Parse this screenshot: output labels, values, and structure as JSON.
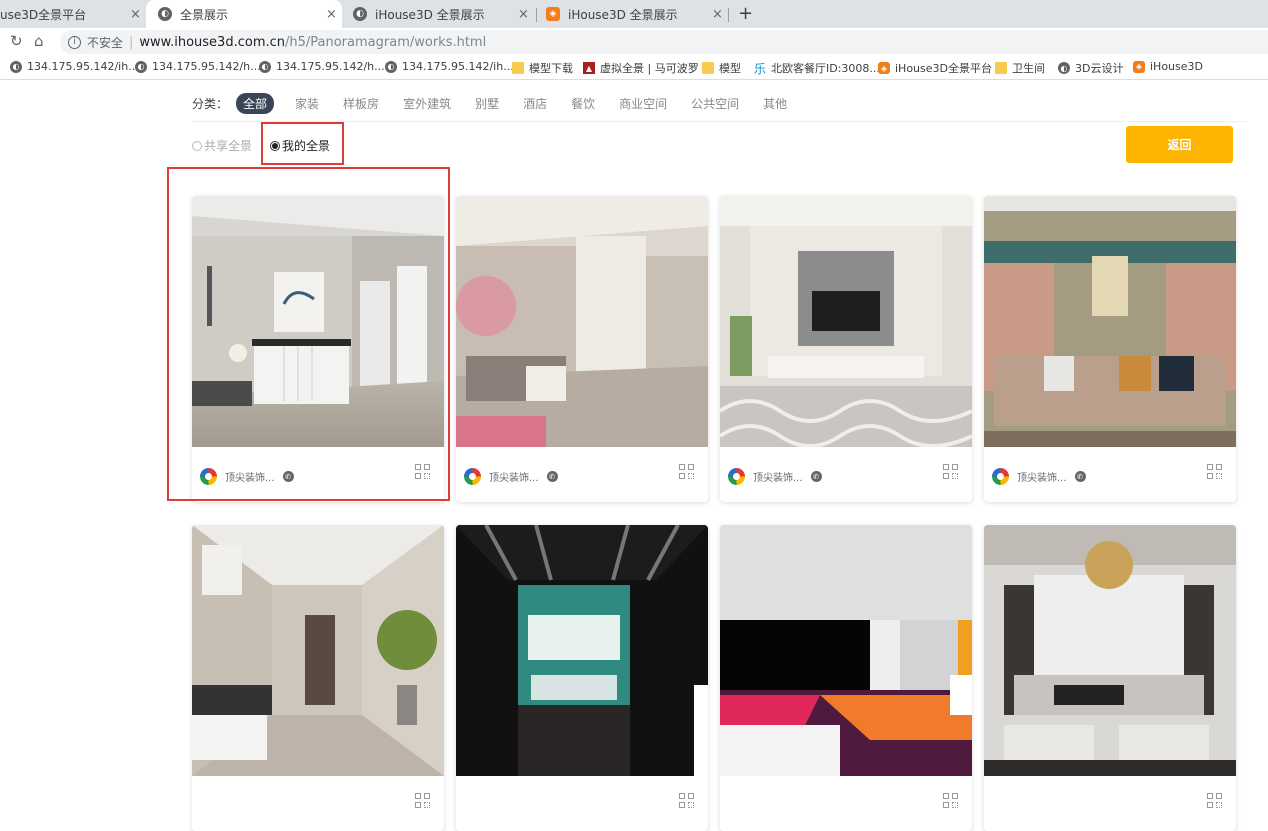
{
  "browser": {
    "tabs": [
      {
        "title": "use3D全景平台",
        "icon": "globe-icon",
        "active": false
      },
      {
        "title": "全景展示",
        "icon": "globe-icon",
        "active": true
      },
      {
        "title": "iHouse3D 全景展示",
        "icon": "globe-icon",
        "active": false
      },
      {
        "title": "iHouse3D 全景展示",
        "icon": "ihouse-logo-icon",
        "active": false
      }
    ],
    "close_glyph": "×",
    "new_tab_glyph": "+",
    "address": {
      "insecure_label": "不安全",
      "host": "www.ihouse3d.com.cn",
      "path": "/h5/Panoramagram/works.html"
    },
    "bookmarks": [
      {
        "label": "134.175.95.142/ih...",
        "icon": "globe-icon"
      },
      {
        "label": "134.175.95.142/h...",
        "icon": "globe-icon"
      },
      {
        "label": "134.175.95.142/h...",
        "icon": "globe-icon"
      },
      {
        "label": "134.175.95.142/ih...",
        "icon": "globe-icon"
      },
      {
        "label": "模型下载",
        "icon": "folder-icon"
      },
      {
        "label": "虚拟全景 | 马可波罗",
        "icon": "vr-logo-icon"
      },
      {
        "label": "模型",
        "icon": "folder-icon"
      },
      {
        "label": "北欧客餐厅ID:3008...",
        "icon": "le-logo-icon"
      },
      {
        "label": "iHouse3D全景平台",
        "icon": "ihouse-logo-icon"
      },
      {
        "label": "卫生间",
        "icon": "folder-icon"
      },
      {
        "label": "3D云设计",
        "icon": "globe-icon"
      },
      {
        "label": "iHouse3D",
        "icon": "ihouse-logo-icon"
      }
    ]
  },
  "filters": {
    "label": "分类：",
    "categories": [
      "全部",
      "家装",
      "样板房",
      "室外建筑",
      "别墅",
      "酒店",
      "餐饮",
      "商业空间",
      "公共空间",
      "其他"
    ],
    "active_category": "全部"
  },
  "scope": {
    "shared_label": "共享全景",
    "mine_label": "我的全景",
    "selected": "我的全景"
  },
  "back_button": "返回",
  "works": [
    {
      "author": "顶尖装饰...",
      "scene": "entryway"
    },
    {
      "author": "顶尖装饰...",
      "scene": "living-room-pink"
    },
    {
      "author": "顶尖装饰...",
      "scene": "tv-wall"
    },
    {
      "author": "顶尖装饰...",
      "scene": "sofa-curtains"
    },
    {
      "author": "",
      "scene": "hallway"
    },
    {
      "author": "",
      "scene": "shop-display"
    },
    {
      "author": "",
      "scene": "room-render"
    },
    {
      "author": "",
      "scene": "chandelier-living"
    }
  ],
  "colors": {
    "accent": "#fcb400",
    "active_category_bg": "#3a4556",
    "highlight_border": "#e03c3c"
  }
}
